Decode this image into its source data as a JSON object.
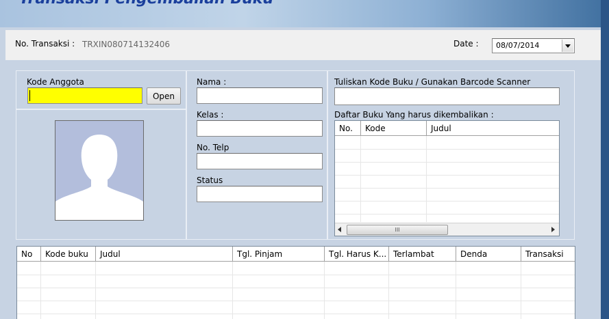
{
  "title": "Transaksi Pengembalian Buku",
  "transaksi": {
    "label": "No. Transaksi :",
    "value": "TRXIN080714132406"
  },
  "date": {
    "label": "Date :",
    "value": "08/07/2014"
  },
  "member": {
    "kode_label": "Kode Anggota",
    "open_label": "Open"
  },
  "fields": {
    "nama_label": "Nama :",
    "kelas_label": "Kelas :",
    "telp_label": "No. Telp",
    "status_label": "Status"
  },
  "book": {
    "scan_label": "Tuliskan Kode Buku / Gunakan Barcode Scanner",
    "list_label": "Daftar Buku Yang harus dikembalikan :",
    "columns": [
      "No.",
      "Kode",
      "Judul"
    ],
    "scroll_grip": "III"
  },
  "main_table": {
    "columns": [
      "No",
      "Kode buku",
      "Judul",
      "Tgl. Pinjam",
      "Tgl. Harus K...",
      "Terlambat",
      "Denda",
      "Transaksi"
    ]
  },
  "colors": {
    "highlight_input": "#ffff00",
    "title": "#1a3f9c"
  }
}
